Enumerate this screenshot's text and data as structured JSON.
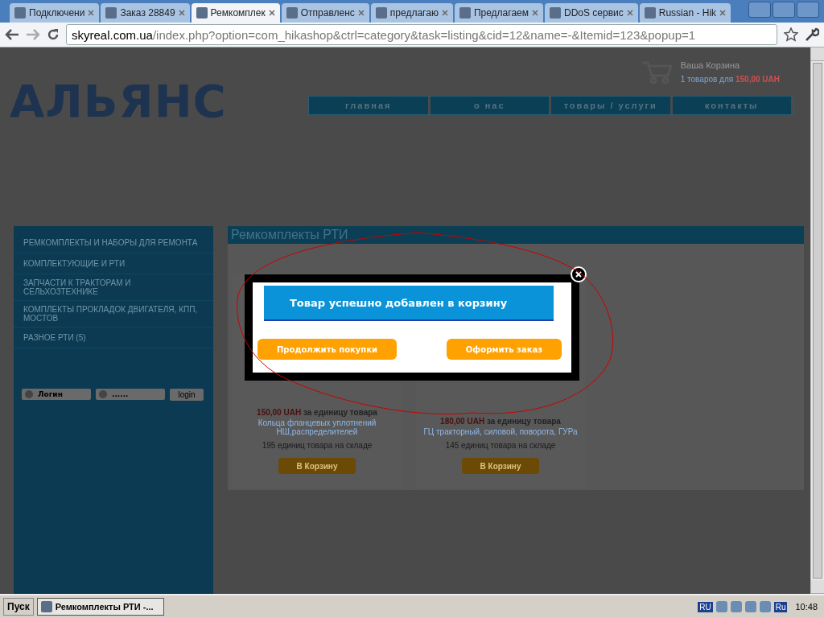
{
  "browser": {
    "tabs": [
      {
        "title": "Подключени",
        "selected": false
      },
      {
        "title": "Заказ 28849",
        "selected": false
      },
      {
        "title": "Ремкомплек",
        "selected": true
      },
      {
        "title": "Отправленс",
        "selected": false
      },
      {
        "title": "предлагаю",
        "selected": false
      },
      {
        "title": "Предлагаем",
        "selected": false
      },
      {
        "title": "DDoS сервис",
        "selected": false
      },
      {
        "title": "Russian - Hik",
        "selected": false
      }
    ],
    "url_host": "skyreal.com.ua",
    "url_path": "/index.php?option=com_hikashop&ctrl=category&task=listing&cid=12&name=-&Itemid=123&popup=1"
  },
  "page": {
    "logo": "АЛЬЯНС",
    "cart": {
      "title": "Ваша Корзина",
      "summary": "1 товаров для",
      "amount": "150,00 UAH"
    },
    "nav": [
      "главная",
      "о нас",
      "товары / услуги",
      "контакты"
    ],
    "sidebar": {
      "items": [
        "РЕМКОМПЛЕКТЫ И НАБОРЫ ДЛЯ РЕМОНТА",
        "КОМПЛЕКТУЮЩИЕ И РТИ",
        "ЗАПЧАСТИ К ТРАКТОРАМ И СЕЛЬХОЗТЕХНИКЕ",
        "КОМПЛЕКТЫ ПРОКЛАДОК ДВИГАТЕЛЯ, КПП, МОСТОВ",
        "РАЗНОЕ РТИ (5)"
      ],
      "login": {
        "placeholder": "Логин",
        "password": "......",
        "button": "login"
      }
    },
    "content": {
      "title": "Ремкомплекты РТИ",
      "products": [
        {
          "price": "150,00 UAH",
          "unit": "за единицу товара",
          "name": "Кольца фланцевых уплотнений НШ,распределителей",
          "stock": "195 единиц товара на складе",
          "button": "В Корзину"
        },
        {
          "price": "180,00 UAH",
          "unit": "за единицу товара",
          "name": "ГЦ тракторный, силовой, поворота, ГУРа",
          "stock": "145 единиц товара на складе",
          "button": "В Корзину"
        }
      ]
    }
  },
  "modal": {
    "message": "Товар успешно добавлен в корзину",
    "buttons": [
      "Продолжить покупки",
      "Оформить заказ"
    ]
  },
  "taskbar": {
    "start": "Пуск",
    "tasks": [
      {
        "title": "Ремкомплекты РТИ -...",
        "selected": true
      }
    ],
    "language": "RU",
    "tray_language": "Ru",
    "clock": "10:48"
  }
}
